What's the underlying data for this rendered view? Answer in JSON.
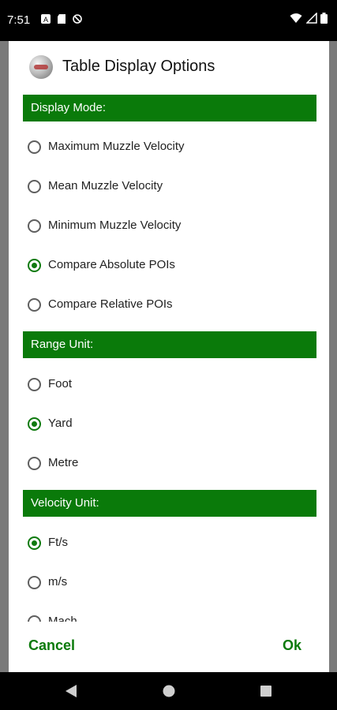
{
  "status_bar": {
    "time": "7:51"
  },
  "dialog": {
    "title": "Table Display Options",
    "sections": {
      "display_mode": {
        "header": "Display Mode:",
        "options": [
          {
            "label": "Maximum Muzzle Velocity",
            "checked": false
          },
          {
            "label": "Mean Muzzle Velocity",
            "checked": false
          },
          {
            "label": "Minimum Muzzle Velocity",
            "checked": false
          },
          {
            "label": "Compare Absolute POIs",
            "checked": true
          },
          {
            "label": "Compare Relative POIs",
            "checked": false
          }
        ]
      },
      "range_unit": {
        "header": "Range Unit:",
        "options": [
          {
            "label": "Foot",
            "checked": false
          },
          {
            "label": "Yard",
            "checked": true
          },
          {
            "label": "Metre",
            "checked": false
          }
        ]
      },
      "velocity_unit": {
        "header": "Velocity Unit:",
        "options": [
          {
            "label": "Ft/s",
            "checked": true
          },
          {
            "label": "m/s",
            "checked": false
          },
          {
            "label": "Mach",
            "checked": false
          }
        ]
      }
    },
    "buttons": {
      "cancel": "Cancel",
      "ok": "Ok"
    }
  },
  "colors": {
    "accent": "#0a7a0a",
    "header_bg": "#0a7a0a"
  }
}
